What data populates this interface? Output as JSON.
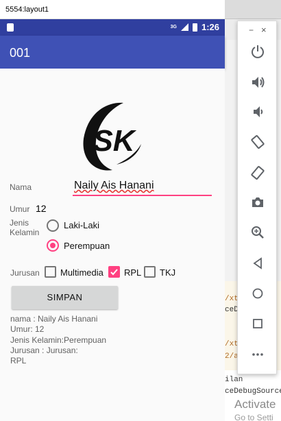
{
  "window": {
    "title": "5554:layout1"
  },
  "status_bar": {
    "network": "3G",
    "time": "1:26"
  },
  "app_bar": {
    "title": "001"
  },
  "logo": {
    "text": "SK"
  },
  "form": {
    "name_label": "Nama",
    "name_value": "Naily Ais Hanani",
    "age_label": "Umur",
    "age_value": "12",
    "gender_label_line1": "Jenis",
    "gender_label_line2": "Kelamin",
    "gender_options": [
      {
        "label": "Laki-Laki",
        "selected": false
      },
      {
        "label": "Perempuan",
        "selected": true
      }
    ],
    "major_label": "Jurusan",
    "major_options": [
      {
        "label": "Multimedia",
        "checked": false
      },
      {
        "label": "RPL",
        "checked": true
      },
      {
        "label": "TKJ",
        "checked": false
      }
    ],
    "save_button": "SIMPAN"
  },
  "result": {
    "line1": "nama : Naily Ais Hanani",
    "line2": "Umur: 12",
    "line3": "Jenis Kelamin:Perempuan",
    "line4": "Jurusan : Jurusan:",
    "line5": "RPL"
  },
  "ide": {
    "code_lines": [
      "/xt",
      "ceDe",
      "/xt",
      "2/a"
    ],
    "console_lines": [
      "ilan",
      "ceDebugSource"
    ],
    "activate": "Activate",
    "activate_sub": "Go to Setti"
  },
  "colors": {
    "primary": "#3f51b5",
    "primary_dark": "#303f9f",
    "accent": "#ff4081"
  },
  "emulator_toolbar": {
    "icons": [
      "power-icon",
      "volume-up-icon",
      "volume-down-icon",
      "rotate-left-icon",
      "rotate-right-icon",
      "camera-icon",
      "zoom-icon",
      "back-icon",
      "home-icon",
      "overview-icon",
      "more-icon"
    ]
  }
}
